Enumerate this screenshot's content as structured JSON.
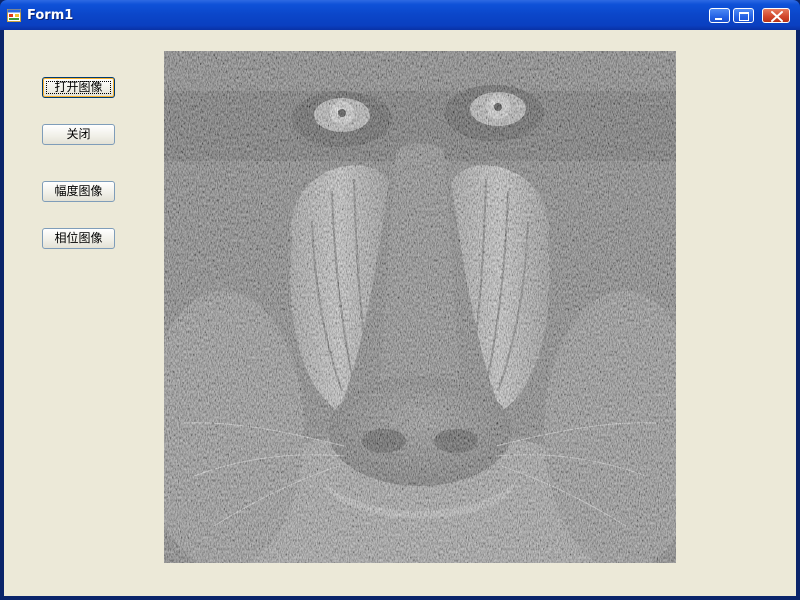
{
  "window": {
    "title": "Form1",
    "icon": "form-app-icon",
    "controls": {
      "minimize": "minimize-icon",
      "maximize": "maximize-icon",
      "close": "close-icon"
    }
  },
  "buttons": {
    "open_image": "打开图像",
    "close": "关闭",
    "magnitude_image": "幅度图像",
    "phase_image": "相位图像"
  },
  "picture": {
    "subject": "grayscale-mandrill-image"
  },
  "colors": {
    "titlebar": "#0b46c9",
    "client_bg": "#ece9d8",
    "close_button": "#d1452a"
  }
}
